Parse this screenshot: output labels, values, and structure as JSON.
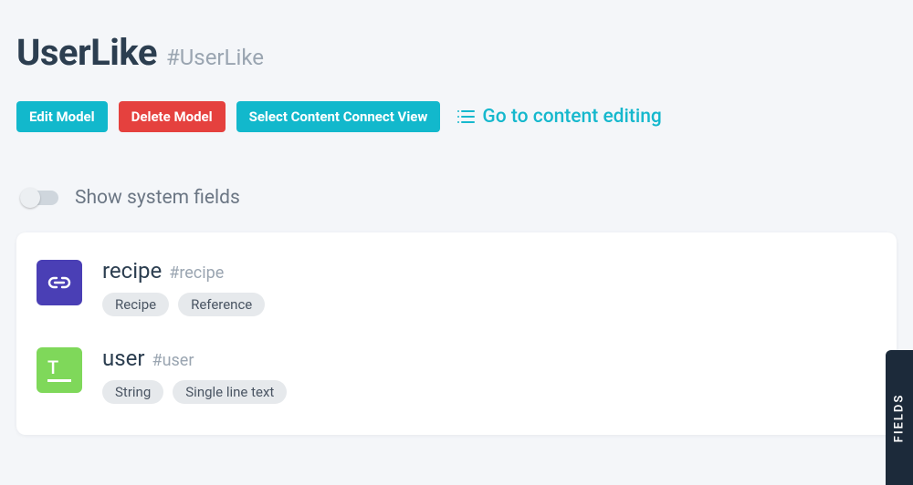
{
  "header": {
    "title": "UserLike",
    "api_id": "#UserLike"
  },
  "actions": {
    "edit": "Edit Model",
    "delete": "Delete Model",
    "select_view": "Select Content Connect View",
    "content_link": "Go to content editing"
  },
  "toggle": {
    "label": "Show system fields"
  },
  "fields": [
    {
      "icon_type": "ref",
      "name": "recipe",
      "api_id": "#recipe",
      "tags": [
        "Recipe",
        "Reference"
      ]
    },
    {
      "icon_type": "str",
      "name": "user",
      "api_id": "#user",
      "tags": [
        "String",
        "Single line text"
      ]
    }
  ],
  "side_tab": "FIELDS"
}
